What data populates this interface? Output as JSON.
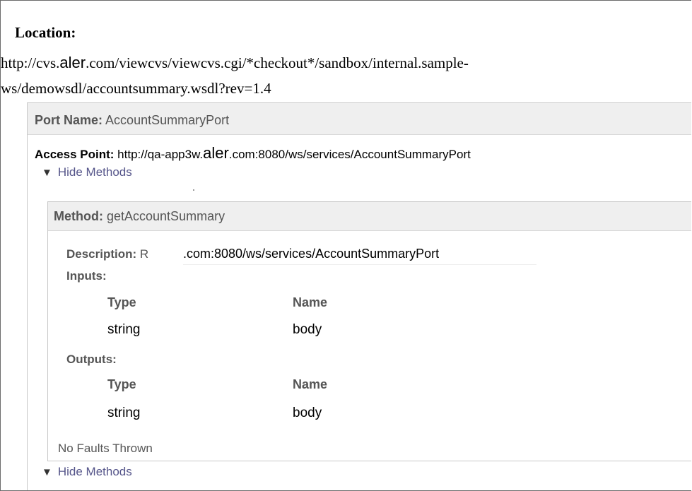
{
  "location": {
    "label": "Location:",
    "url_line1": "http://cvs.aler.com/viewcvs/viewcvs.cgi/*checkout*/sandbox/internal.sample-",
    "url_line2": "ws/demowsdl/accountsummary.wsdl?rev=1.4"
  },
  "port": {
    "name_label": "Port Name:",
    "name_value": "AccountSummaryPort",
    "access_label": "Access Point:",
    "access_value": "http://qa-app3w.aler.com:8080/ws/services/AccountSummaryPort",
    "toggle_top": "Hide Methods",
    "toggle_bottom": "Hide Methods"
  },
  "method": {
    "label": "Method:",
    "name": "getAccountSummary",
    "description_label": "Description:",
    "description_value": "R",
    "description_overlay": ".com:8080/ws/services/AccountSummaryPort",
    "inputs_label": "Inputs:",
    "outputs_label": "Outputs:",
    "columns": [
      "Type",
      "Name"
    ],
    "inputs": [
      {
        "type": "string",
        "name": "body"
      }
    ],
    "outputs": [
      {
        "type": "string",
        "name": "body"
      }
    ],
    "faults": "No Faults Thrown"
  },
  "icons": {
    "toggle_arrow": "triangle-down-icon"
  }
}
